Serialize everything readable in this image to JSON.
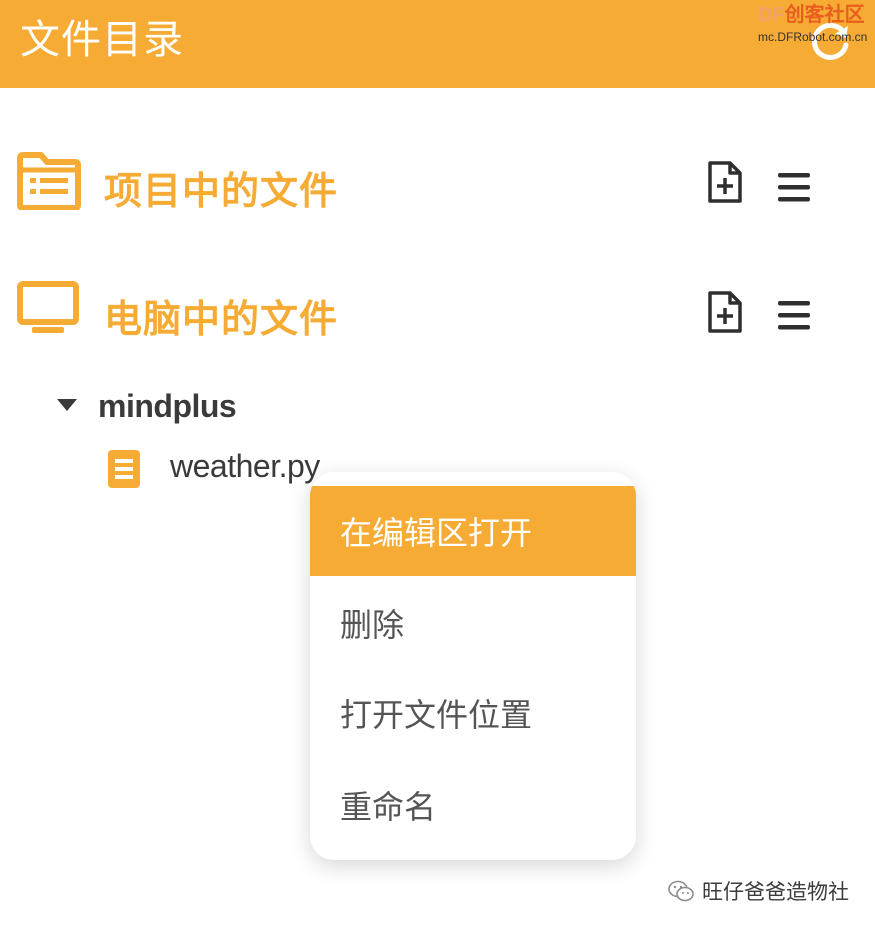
{
  "header": {
    "title": "文件目录",
    "watermark_logo_df": "DF",
    "watermark_logo_text": "创客社区",
    "watermark_url": "mc.DFRobot.com.cn"
  },
  "sections": [
    {
      "title": "项目中的文件",
      "icon": "folder-list-icon"
    },
    {
      "title": "电脑中的文件",
      "icon": "monitor-icon"
    }
  ],
  "tree": {
    "folder": {
      "name": "mindplus",
      "expanded": true
    },
    "files": [
      {
        "name": "weather.py",
        "icon": "file-text-icon"
      }
    ]
  },
  "context_menu": {
    "items": [
      {
        "label": "在编辑区打开",
        "active": true
      },
      {
        "label": "删除",
        "active": false
      },
      {
        "label": "打开文件位置",
        "active": false
      },
      {
        "label": "重命名",
        "active": false
      }
    ]
  },
  "watermark_bottom": {
    "text": "旺仔爸爸造物社"
  },
  "colors": {
    "accent": "#f6ab34",
    "icon_dark": "#2f2f2f",
    "text": "#3a3a3a",
    "menu_text": "#555555"
  }
}
